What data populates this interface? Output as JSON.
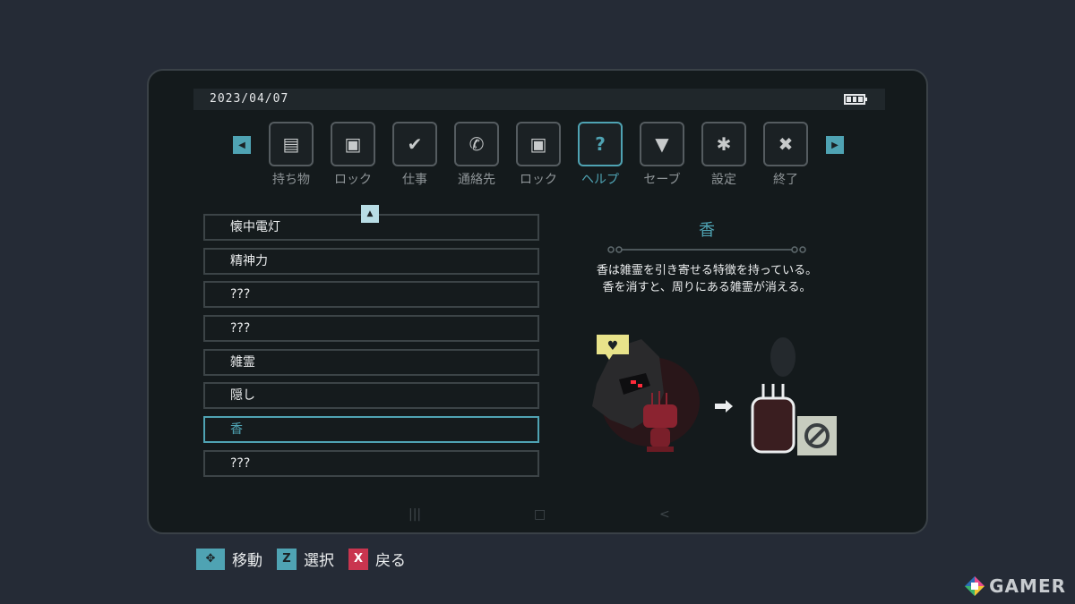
{
  "status_bar": {
    "date": "2023/04/07"
  },
  "tabs": [
    {
      "label": "持ち物",
      "icon": "briefcase-icon",
      "glyph": "▤"
    },
    {
      "label": "ロック",
      "icon": "lock-panel-icon",
      "glyph": "▣"
    },
    {
      "label": "仕事",
      "icon": "checklist-icon",
      "glyph": "✔"
    },
    {
      "label": "通絡先",
      "icon": "phone-icon",
      "glyph": "✆"
    },
    {
      "label": "ロック",
      "icon": "lock-panel-icon",
      "glyph": "▣"
    },
    {
      "label": "ヘルプ",
      "icon": "help-icon",
      "glyph": "?"
    },
    {
      "label": "セーブ",
      "icon": "save-folder-icon",
      "glyph": "▼"
    },
    {
      "label": "設定",
      "icon": "gear-icon",
      "glyph": "✱"
    },
    {
      "label": "終了",
      "icon": "close-icon",
      "glyph": "✖"
    }
  ],
  "active_tab": "ヘルプ",
  "nav": {
    "left_glyph": "◀",
    "right_glyph": "▶",
    "scroll_up_glyph": "▲"
  },
  "help_list": [
    "懐中電灯",
    "精神力",
    "???",
    "???",
    "雑霊",
    "隠し",
    "香",
    "???"
  ],
  "selected_item": "香",
  "detail": {
    "title": "香",
    "description_line1": "香は雑霊を引き寄せる特徴を持っている。",
    "description_line2": "香を消すと、周りにある雑霊が消える。"
  },
  "footer_nav": {
    "recent_glyph": "|||",
    "home_glyph": "□",
    "back_glyph": "<"
  },
  "controls": [
    {
      "key": "✥",
      "label": "移動"
    },
    {
      "key": "Z",
      "label": "選択"
    },
    {
      "key": "X",
      "label": "戻る"
    }
  ],
  "watermark": "GAMER",
  "colors": {
    "accent": "#4fa3b3",
    "background": "#252b36",
    "panel": "#141a1c",
    "cancel_key": "#c9354f",
    "incense": "#8b2330",
    "speech_bubble": "#e8e38a"
  }
}
